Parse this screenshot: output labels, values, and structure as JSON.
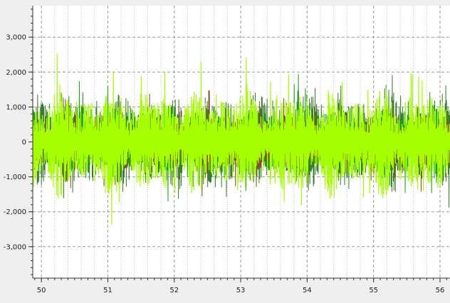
{
  "chart_data": {
    "type": "line",
    "title": "",
    "xlabel": "",
    "ylabel": "",
    "xlim": [
      49.87,
      56.15
    ],
    "ylim": [
      -3900,
      3900
    ],
    "x_ticks": [
      50,
      51,
      52,
      53,
      54,
      55,
      56
    ],
    "y_ticks": [
      -3000,
      -2000,
      -1000,
      0,
      1000,
      2000,
      3000
    ],
    "y_tick_labels": [
      "-3,000",
      "-2,000",
      "-1,000",
      "0",
      "1,000",
      "2,000",
      "3,000"
    ],
    "grid": true,
    "minor_x_grid_step": 0.2,
    "series": [
      {
        "color": "#3a7d2e",
        "typical_amplitude": 1500,
        "peak_amplitude": 2300
      },
      {
        "color": "#1a9e1a",
        "typical_amplitude": 1200,
        "peak_amplitude": 2000
      },
      {
        "color": "#8b4a2b",
        "typical_amplitude": 1000,
        "peak_amplitude": 1700
      },
      {
        "color": "#a6ff00",
        "typical_amplitude": 1700,
        "peak_amplitude": 2800
      }
    ]
  }
}
